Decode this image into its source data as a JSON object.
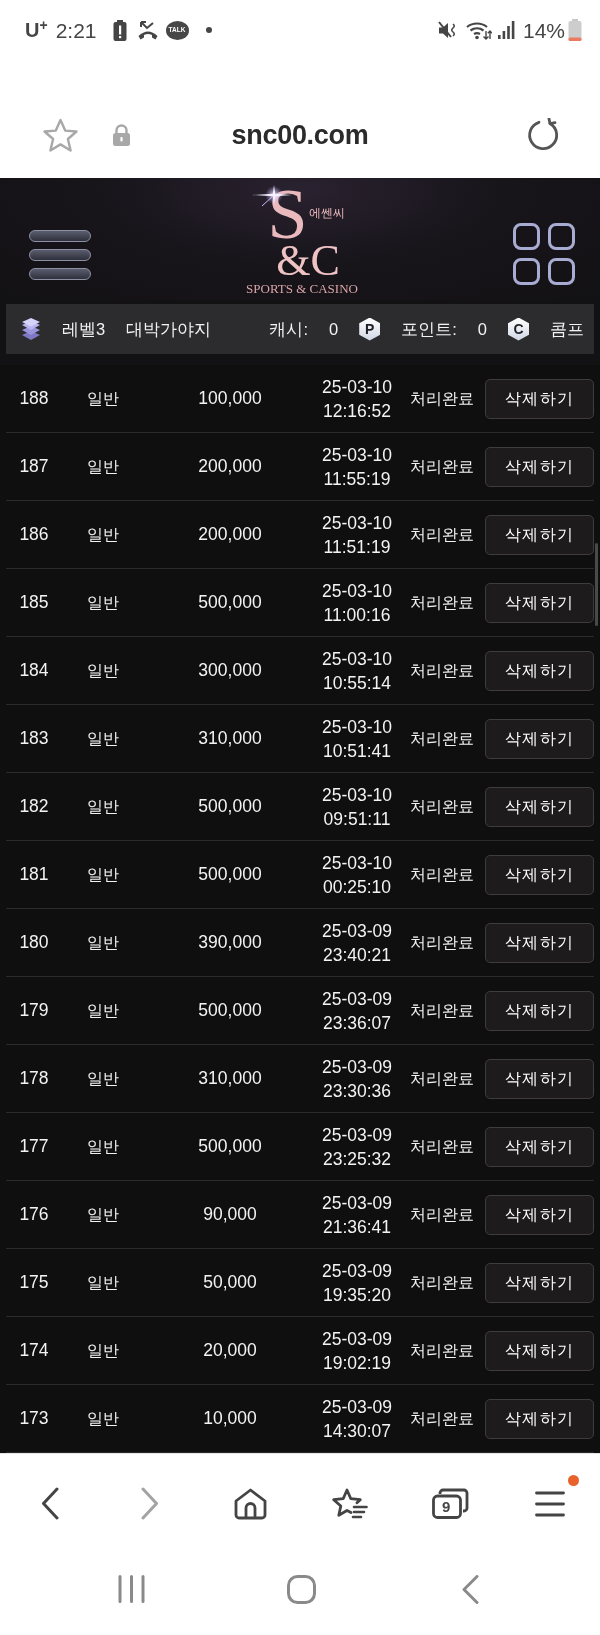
{
  "status_bar": {
    "carrier": "U$^{+}$",
    "time": "2:21",
    "chat_badge": "TALK",
    "battery": "14%"
  },
  "address_bar": {
    "url": "snc00.com"
  },
  "site_header": {
    "logo": {
      "mark_top": "S",
      "korean": "에쎈씨",
      "mark_bottom": "&C",
      "tagline": "SPORTS & CASINO"
    }
  },
  "user_bar": {
    "level": "레벨3",
    "nickname": "대박가야지",
    "cash_label": "캐시:",
    "cash": "0",
    "point_badge": "P",
    "points_label": "포인트:",
    "points": "0",
    "comp_badge": "C",
    "comp_label": "콤프"
  },
  "table": {
    "rows": [
      {
        "no": "188",
        "type": "일반",
        "amount": "100,000",
        "date": "25-03-10",
        "time": "12:16:52",
        "status": "처리완료",
        "action": "삭제하기"
      },
      {
        "no": "187",
        "type": "일반",
        "amount": "200,000",
        "date": "25-03-10",
        "time": "11:55:19",
        "status": "처리완료",
        "action": "삭제하기"
      },
      {
        "no": "186",
        "type": "일반",
        "amount": "200,000",
        "date": "25-03-10",
        "time": "11:51:19",
        "status": "처리완료",
        "action": "삭제하기"
      },
      {
        "no": "185",
        "type": "일반",
        "amount": "500,000",
        "date": "25-03-10",
        "time": "11:00:16",
        "status": "처리완료",
        "action": "삭제하기"
      },
      {
        "no": "184",
        "type": "일반",
        "amount": "300,000",
        "date": "25-03-10",
        "time": "10:55:14",
        "status": "처리완료",
        "action": "삭제하기"
      },
      {
        "no": "183",
        "type": "일반",
        "amount": "310,000",
        "date": "25-03-10",
        "time": "10:51:41",
        "status": "처리완료",
        "action": "삭제하기"
      },
      {
        "no": "182",
        "type": "일반",
        "amount": "500,000",
        "date": "25-03-10",
        "time": "09:51:11",
        "status": "처리완료",
        "action": "삭제하기"
      },
      {
        "no": "181",
        "type": "일반",
        "amount": "500,000",
        "date": "25-03-10",
        "time": "00:25:10",
        "status": "처리완료",
        "action": "삭제하기"
      },
      {
        "no": "180",
        "type": "일반",
        "amount": "390,000",
        "date": "25-03-09",
        "time": "23:40:21",
        "status": "처리완료",
        "action": "삭제하기"
      },
      {
        "no": "179",
        "type": "일반",
        "amount": "500,000",
        "date": "25-03-09",
        "time": "23:36:07",
        "status": "처리완료",
        "action": "삭제하기"
      },
      {
        "no": "178",
        "type": "일반",
        "amount": "310,000",
        "date": "25-03-09",
        "time": "23:30:36",
        "status": "처리완료",
        "action": "삭제하기"
      },
      {
        "no": "177",
        "type": "일반",
        "amount": "500,000",
        "date": "25-03-09",
        "time": "23:25:32",
        "status": "처리완료",
        "action": "삭제하기"
      },
      {
        "no": "176",
        "type": "일반",
        "amount": "90,000",
        "date": "25-03-09",
        "time": "21:36:41",
        "status": "처리완료",
        "action": "삭제하기"
      },
      {
        "no": "175",
        "type": "일반",
        "amount": "50,000",
        "date": "25-03-09",
        "time": "19:35:20",
        "status": "처리완료",
        "action": "삭제하기"
      },
      {
        "no": "174",
        "type": "일반",
        "amount": "20,000",
        "date": "25-03-09",
        "time": "19:02:19",
        "status": "처리완료",
        "action": "삭제하기"
      },
      {
        "no": "173",
        "type": "일반",
        "amount": "10,000",
        "date": "25-03-09",
        "time": "14:30:07",
        "status": "처리완료",
        "action": "삭제하기"
      }
    ]
  },
  "browser_toolbar": {
    "items": [
      {
        "kind": "back",
        "disabled": false
      },
      {
        "kind": "forward",
        "disabled": true
      },
      {
        "kind": "home",
        "disabled": false
      },
      {
        "kind": "bookmarks",
        "disabled": false
      },
      {
        "kind": "tabs",
        "count": "9",
        "disabled": false
      },
      {
        "kind": "menu",
        "notification": true,
        "disabled": false
      }
    ]
  }
}
